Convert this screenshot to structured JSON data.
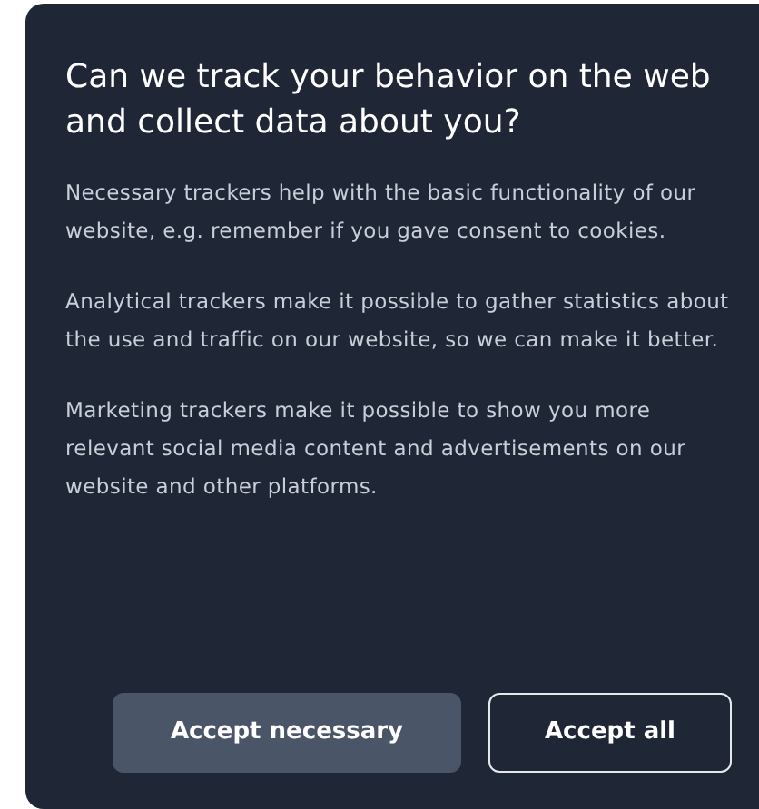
{
  "dialog": {
    "title": "Can we track your behavior on the web and collect data about you?",
    "paragraphs": [
      "Necessary trackers help with the basic functionality of our website, e.g. remember if you gave consent to cookies.",
      "Analytical trackers make it possible to gather statistics about the use and traffic on our website, so we can make it better.",
      "Marketing trackers make it possible to show you more relevant social media content and advertisements on our website and other platforms."
    ],
    "buttons": [
      {
        "label": "Accept necessary",
        "kind": "filled"
      },
      {
        "label": "Accept all",
        "kind": "outline"
      }
    ]
  }
}
